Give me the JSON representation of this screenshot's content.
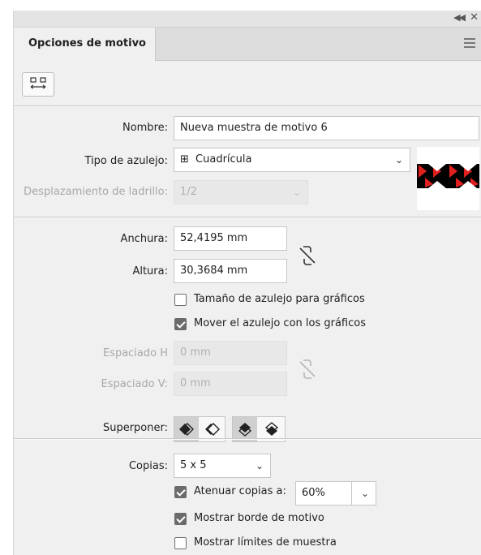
{
  "panel": {
    "tab_label": "Opciones de motivo",
    "icons": {
      "collapse": "double-chevron-left-icon",
      "close": "close-icon",
      "menu": "hamburger-menu-icon",
      "tile_tool": "pattern-tile-tool-icon",
      "link_size": "unlink-chain-icon",
      "link_spacing": "unlink-chain-icon"
    }
  },
  "form": {
    "name_label": "Nombre:",
    "name_value": "Nueva muestra de motivo 6",
    "tile_type_label": "Tipo de azulejo:",
    "tile_type_value": "Cuadrícula",
    "brick_offset_label": "Desplazamiento de ladrillo:",
    "brick_offset_value": "1/2",
    "width_label": "Anchura:",
    "width_value": "52,4195 mm",
    "height_label": "Altura:",
    "height_value": "30,3684 mm",
    "size_tile_to_art_label": "Tamaño de azulejo para gráficos",
    "size_tile_to_art_checked": false,
    "move_tile_with_art_label": "Mover el azulejo con los gráficos",
    "move_tile_with_art_checked": true,
    "h_spacing_label": "Espaciado H",
    "h_spacing_value": "0 mm",
    "v_spacing_label": "Espaciado V:",
    "v_spacing_value": "0 mm",
    "overlap_label": "Superponer:",
    "copies_label": "Copias:",
    "copies_value": "5 x 5",
    "dim_copies_label": "Atenuar copias a:",
    "dim_copies_checked": true,
    "dim_copies_value": "60%",
    "show_tile_edge_label": "Mostrar borde de motivo",
    "show_tile_edge_checked": true,
    "show_swatch_bounds_label": "Mostrar límites de muestra",
    "show_swatch_bounds_checked": false
  },
  "colors": {
    "panel_bg": "#f0f0f0",
    "preview_red": "#e0201f",
    "preview_black": "#000000"
  }
}
